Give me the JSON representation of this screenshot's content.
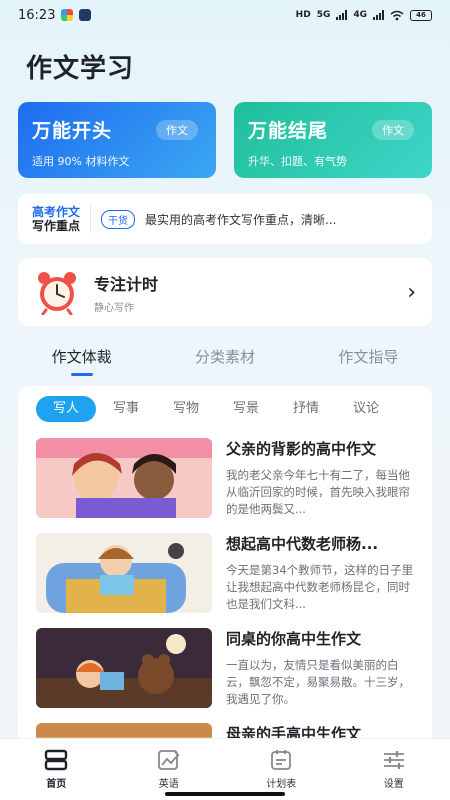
{
  "status_bar": {
    "time": "16:23",
    "network_labels": [
      "HD",
      "5G",
      "4G"
    ],
    "battery": "46"
  },
  "page_title": "作文学习",
  "cards": [
    {
      "title": "万能开头",
      "tag": "作文",
      "subtitle": "适用 90% 材料作文",
      "color": "#1f6cf0"
    },
    {
      "title": "万能结尾",
      "tag": "作文",
      "subtitle": "升华、扣题、有气势",
      "color": "#1fbf9a"
    }
  ],
  "notice": {
    "logo_line1": "高考作文",
    "logo_line2": "写作重点",
    "tag": "干货",
    "text": "最实用的高考作文写作重点，清晰..."
  },
  "focus": {
    "title": "专注计时",
    "subtitle": "静心写作"
  },
  "tabs": [
    "作文体裁",
    "分类素材",
    "作文指导"
  ],
  "active_tab": 0,
  "chips": [
    "写人",
    "写事",
    "写物",
    "写景",
    "抒情",
    "议论"
  ],
  "active_chip": 0,
  "articles": [
    {
      "title": "父亲的背影的高中作文",
      "excerpt": "我的老父亲今年七十有二了，每当他从临沂回家的时候，首先映入我眼帘的是他两鬓又..."
    },
    {
      "title": "想起高中代数老师杨...",
      "excerpt": "今天是第34个教师节，这样的日子里让我想起高中代数老师杨昆仑，同时也是我们文科..."
    },
    {
      "title": "同桌的你高中生作文",
      "excerpt": "一直以为，友情只是看似美丽的白云，飘忽不定，易聚易散。十三岁，我遇见了你。"
    },
    {
      "title": "母亲的手高中生作文",
      "excerpt": ""
    }
  ],
  "bottom_nav": [
    {
      "label": "首页",
      "icon": "home-icon"
    },
    {
      "label": "英语",
      "icon": "english-icon"
    },
    {
      "label": "计划表",
      "icon": "calendar-icon"
    },
    {
      "label": "设置",
      "icon": "settings-icon"
    }
  ],
  "accent_color": "#1f6cf0"
}
